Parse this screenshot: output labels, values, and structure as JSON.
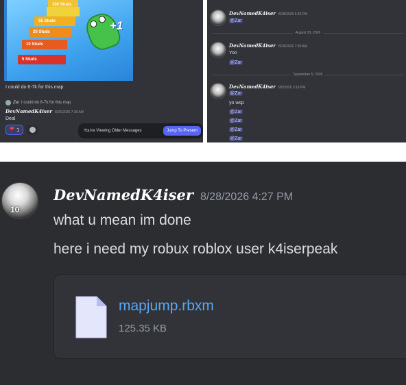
{
  "panel1": {
    "game_steps": [
      "100 Studs",
      "55 Studs",
      "20 Studs",
      "10 Studs",
      "5 Studs"
    ],
    "game_plus": "+1",
    "message1": "I could do 6-7k for this map",
    "reply_name": "Zar",
    "reply_text": "I could do 6-7k for this map",
    "author": "DevNamedK4iser",
    "time": "8/26/2026 7:36 AM",
    "message2": "Deal",
    "reaction_count": "1",
    "older_text": "You're Viewing Older Messages",
    "jump_label": "Jump To Present"
  },
  "panel2": {
    "msg1": {
      "author": "DevNamedK4iser",
      "time": "8/28/2026 5:23 PM",
      "lines": [
        "@Zar"
      ]
    },
    "divider1": "August 29, 2026",
    "msg2": {
      "author": "DevNamedK4iser",
      "time": "8/29/2026 7:30 AM",
      "lines": [
        "Yoo",
        "@Zar"
      ]
    },
    "divider2": "September 5, 2026",
    "msg3": {
      "author": "DevNamedK4iser",
      "time": "9/5/2026 3:19 PM",
      "lines": [
        "@Zar",
        "yo wsp",
        "@Zar",
        "@Zar",
        "@Zar",
        "@Zar"
      ]
    }
  },
  "panel3": {
    "author": "DevNamedK4iser",
    "time": "8/28/2026 4:27 PM",
    "line1": "what u mean im done",
    "line2": "here i need my robux roblox user k4iserpeak",
    "avatar_number": "10",
    "file": {
      "name": "mapjump.rbxm",
      "size": "125.35 KB"
    }
  },
  "colors": {
    "accent": "#5865f2",
    "mention": "#c9cdfb",
    "link": "#5aa7f5",
    "bg": "#313338"
  }
}
